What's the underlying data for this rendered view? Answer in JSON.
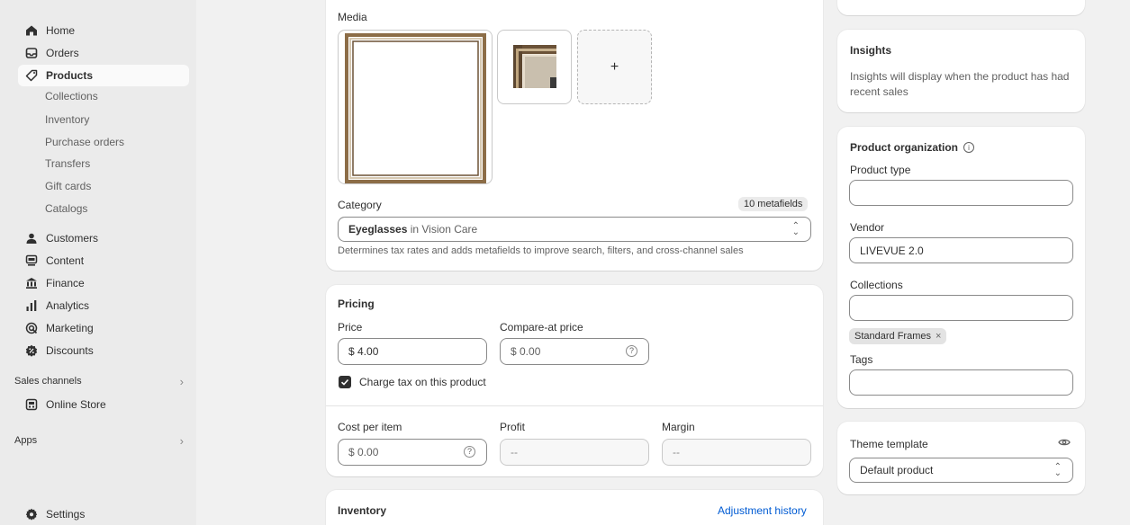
{
  "sidebar": {
    "items": [
      {
        "label": "Home",
        "icon": "home-icon"
      },
      {
        "label": "Orders",
        "icon": "inbox-icon"
      },
      {
        "label": "Products",
        "icon": "tag-icon"
      },
      {
        "label": "Customers",
        "icon": "person-icon"
      },
      {
        "label": "Content",
        "icon": "content-icon"
      },
      {
        "label": "Finance",
        "icon": "bank-icon"
      },
      {
        "label": "Analytics",
        "icon": "bar-chart-icon"
      },
      {
        "label": "Marketing",
        "icon": "target-icon"
      },
      {
        "label": "Discounts",
        "icon": "discount-icon"
      }
    ],
    "product_sub": [
      "Collections",
      "Inventory",
      "Purchase orders",
      "Transfers",
      "Gift cards",
      "Catalogs"
    ],
    "sales_channels": "Sales channels",
    "online_store": "Online Store",
    "apps": "Apps",
    "settings": "Settings"
  },
  "media": {
    "label": "Media",
    "add": "+"
  },
  "category": {
    "label": "Category",
    "metafields_badge": "10 metafields",
    "value_strong": "Eyeglasses",
    "value_rest": " in Vision Care",
    "help": "Determines tax rates and adds metafields to improve search, filters, and cross-channel sales"
  },
  "pricing": {
    "title": "Pricing",
    "price_label": "Price",
    "price_value": "$ 4.00",
    "compare_label": "Compare-at price",
    "compare_value": "$ 0.00",
    "charge_tax": "Charge tax on this product",
    "cost_label": "Cost per item",
    "cost_value": "$ 0.00",
    "profit_label": "Profit",
    "profit_value": "--",
    "margin_label": "Margin",
    "margin_value": "--"
  },
  "inventory": {
    "title": "Inventory",
    "adjustment_link": "Adjustment history"
  },
  "insights": {
    "title": "Insights",
    "text": "Insights will display when the product has had recent sales"
  },
  "organization": {
    "title": "Product organization",
    "product_type_label": "Product type",
    "product_type_value": "",
    "vendor_label": "Vendor",
    "vendor_value": "LIVEVUE 2.0",
    "collections_label": "Collections",
    "collections_value": "",
    "collection_chip": "Standard Frames",
    "tags_label": "Tags",
    "tags_value": ""
  },
  "theme": {
    "label": "Theme template",
    "value": "Default product"
  },
  "colors": {
    "accent_link": "#005bd3",
    "checkbox": "#303030",
    "background": "#f1f1f1"
  }
}
